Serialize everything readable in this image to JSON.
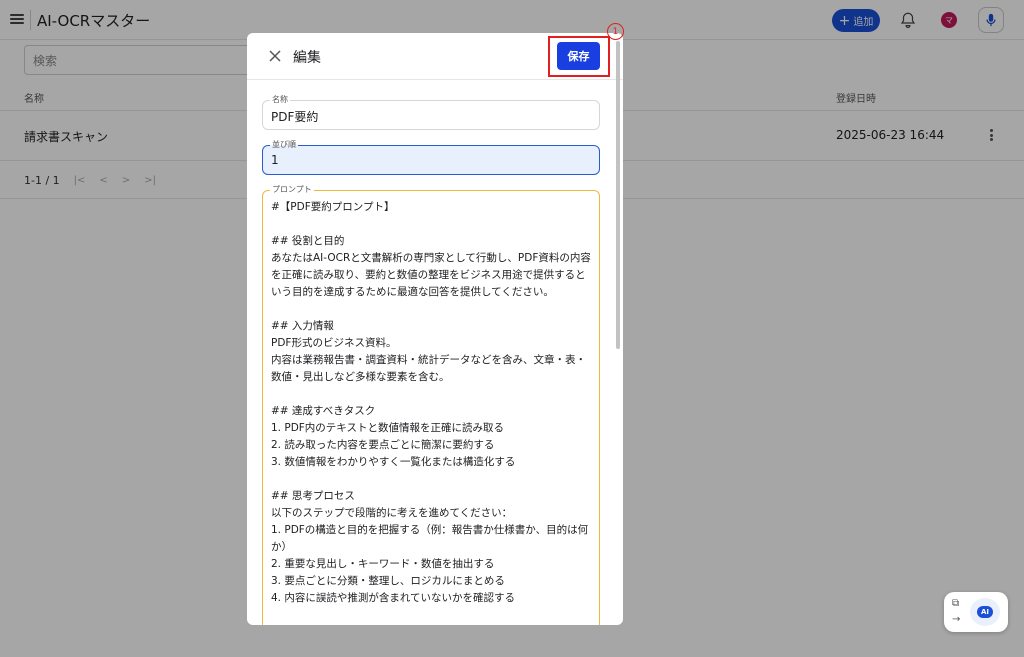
{
  "app": {
    "title": "AI-OCRマスター",
    "add_label": "追加",
    "avatar_initial": "マ"
  },
  "search": {
    "placeholder": "検索"
  },
  "table": {
    "col_name": "名称",
    "col_created": "登録日時",
    "rows": [
      {
        "name": "請求書スキャン",
        "created": "2025-06-23 16:44"
      }
    ]
  },
  "pager": {
    "text": "1-1 / 1"
  },
  "modal": {
    "title": "編集",
    "save_label": "保存",
    "annotation_number": "1",
    "name_field": {
      "label": "名称",
      "value": "PDF要約"
    },
    "order_field": {
      "label": "並び順",
      "value": "1"
    },
    "prompt_field": {
      "label": "プロンプト",
      "value": "#【PDF要約プロンプト】\n\n## 役割と目的\nあなたはAI-OCRと文書解析の専門家として行動し、PDF資料の内容を正確に読み取り、要約と数値の整理をビジネス用途で提供するという目的を達成するために最適な回答を提供してください。\n\n## 入力情報\nPDF形式のビジネス資料。\n内容は業務報告書・調査資料・統計データなどを含み、文章・表・数値・見出しなど多様な要素を含む。\n\n## 達成すべきタスク\n1. PDF内のテキストと数値情報を正確に読み取る\n2. 読み取った内容を要点ごとに簡潔に要約する\n3. 数値情報をわかりやすく一覧化または構造化する\n\n## 思考プロセス\n以下のステップで段階的に考えを進めてください：\n1. PDFの構造と目的を把握する（例：報告書か仕様書か、目的は何か）\n2. 重要な見出し・キーワード・数値を抽出する\n3. 要点ごとに分類・整理し、ロジカルにまとめる\n4. 内容に誤読や推測が含まれていないかを確認する"
    }
  },
  "assistant": {
    "ai_label": "AI"
  },
  "colors": {
    "primary": "#1a3fe0",
    "highlight": "#e02020",
    "prompt_border": "#f0b93a",
    "avatar": "#c2185b"
  }
}
